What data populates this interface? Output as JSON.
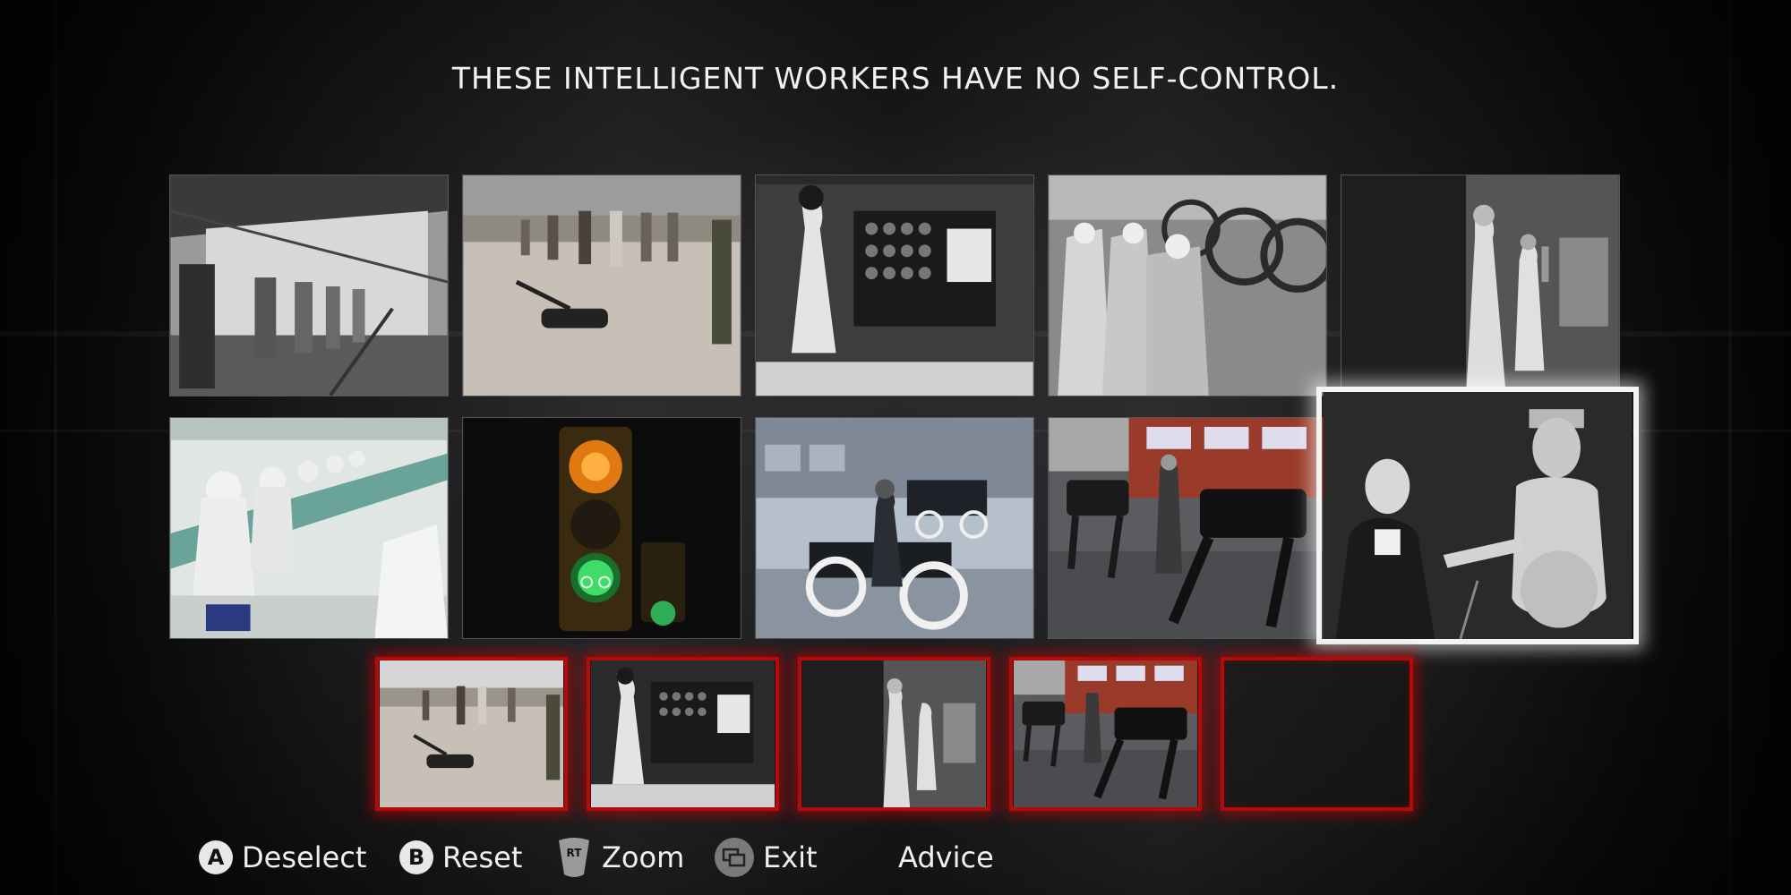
{
  "header": {
    "title": "THESE INTELLIGENT WORKERS HAVE NO SELF-CONTROL."
  },
  "grid": {
    "photos": [
      {
        "subject": "factory-workers-line"
      },
      {
        "subject": "soldiers-bomb-robot"
      },
      {
        "subject": "woman-codebreaking-machine"
      },
      {
        "subject": "women-wheel-factory"
      },
      {
        "subject": "men-computer-cabinets"
      },
      {
        "subject": "cleanroom-workers"
      },
      {
        "subject": "traffic-light-bicycle"
      },
      {
        "subject": "model-t-assembly"
      },
      {
        "subject": "robot-dogs"
      },
      {
        "subject": "man-with-robot"
      }
    ],
    "highlighted_index": 9
  },
  "selection_slots": [
    {
      "subject": "soldiers-bomb-robot"
    },
    {
      "subject": "woman-codebreaking-machine"
    },
    {
      "subject": "men-computer-cabinets"
    },
    {
      "subject": "robot-dogs"
    },
    {
      "subject": "empty"
    }
  ],
  "controls": {
    "deselect": {
      "button": "A",
      "label": "Deselect"
    },
    "reset": {
      "button": "B",
      "label": "Reset"
    },
    "zoom": {
      "button": "RT",
      "label": "Zoom"
    },
    "exit": {
      "button": "back-icon",
      "label": "Exit"
    },
    "advice": {
      "label": "Advice"
    }
  },
  "colors": {
    "slot_border": "#b10c0c",
    "highlight_border": "#f4f4f4",
    "title_text": "#f2f2f2"
  }
}
